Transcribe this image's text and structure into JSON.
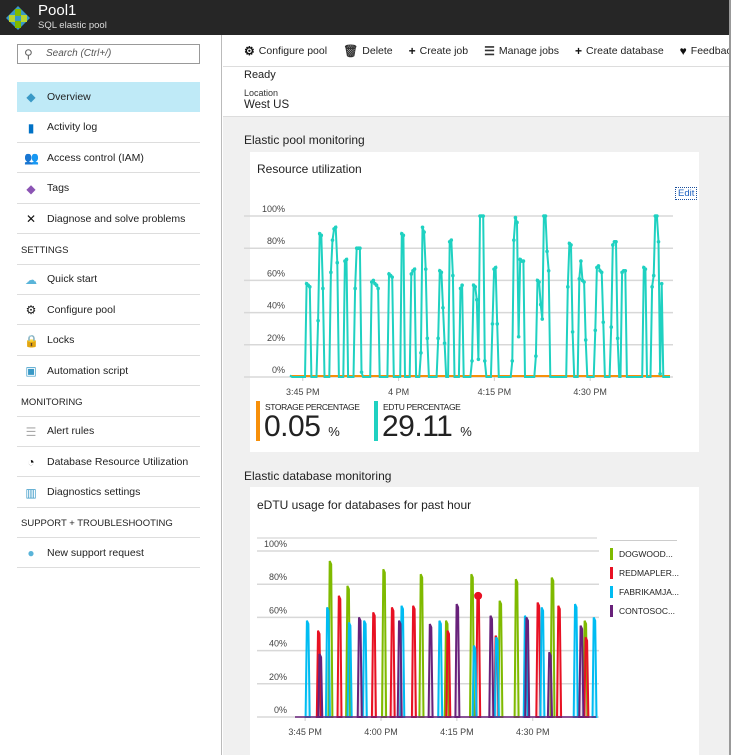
{
  "header": {
    "title": "Pool1",
    "subtitle": "SQL elastic pool",
    "icon": "sql-elastic-pool-icon"
  },
  "sidebar": {
    "search_placeholder": "Search (Ctrl+/)",
    "items": [
      {
        "label": "Overview",
        "icon": "overview-icon",
        "selected": true
      },
      {
        "label": "Activity log",
        "icon": "activity-log-icon"
      },
      {
        "label": "Access control (IAM)",
        "icon": "access-control-icon"
      },
      {
        "label": "Tags",
        "icon": "tag-icon"
      },
      {
        "label": "Diagnose and solve problems",
        "icon": "wrench-icon"
      }
    ],
    "sections": [
      {
        "title": "SETTINGS",
        "items": [
          {
            "label": "Quick start",
            "icon": "cloud-icon"
          },
          {
            "label": "Configure pool",
            "icon": "gear-icon"
          },
          {
            "label": "Locks",
            "icon": "lock-icon"
          },
          {
            "label": "Automation script",
            "icon": "monitor-icon"
          }
        ]
      },
      {
        "title": "MONITORING",
        "items": [
          {
            "label": "Alert rules",
            "icon": "list-icon"
          },
          {
            "label": "Database Resource Utilization",
            "icon": "gauge-icon"
          },
          {
            "label": "Diagnostics settings",
            "icon": "chart-icon"
          }
        ]
      },
      {
        "title": "SUPPORT + TROUBLESHOOTING",
        "items": [
          {
            "label": "New support request",
            "icon": "support-icon"
          }
        ]
      }
    ]
  },
  "toolbar": [
    {
      "label": "Configure pool",
      "icon": "gear-icon"
    },
    {
      "label": "Delete",
      "icon": "trash-icon"
    },
    {
      "label": "Create job",
      "icon": "plus-icon"
    },
    {
      "label": "Manage jobs",
      "icon": "checklist-icon"
    },
    {
      "label": "Create database",
      "icon": "plus-icon"
    },
    {
      "label": "Feedback",
      "icon": "heart-icon"
    }
  ],
  "essentials": {
    "status": "Ready",
    "location_label": "Location",
    "location": "West US"
  },
  "pool_monitoring": {
    "section_title": "Elastic pool monitoring",
    "card_title": "Resource utilization",
    "edit_label": "Edit",
    "storage": {
      "label": "STORAGE PERCENTAGE",
      "value": "0.05",
      "unit": "%",
      "color": "#f7900a"
    },
    "edtu": {
      "label": "EDTU PERCENTAGE",
      "value": "29.11",
      "unit": "%",
      "color": "#1fd1c1"
    }
  },
  "db_monitoring": {
    "section_title": "Elastic database monitoring",
    "card_title": "eDTU usage for databases for past hour"
  },
  "chart_data": [
    {
      "type": "line",
      "xlim": [
        "15:43:00",
        "16:42:30"
      ],
      "ylim": [
        0,
        100
      ],
      "xticks": [
        "3:45 PM",
        "4 PM",
        "4:15 PM",
        "4:30 PM"
      ],
      "yticks": [
        "0%",
        "20%",
        "40%",
        "60%",
        "80%",
        "100%"
      ],
      "grid": true,
      "sample_interval_seconds": 15,
      "series": [
        {
          "name": "EDTU PERCENTAGE",
          "color": "#1fd1c1",
          "spikes": [
            {
              "start": "15:45:36",
              "values": [
                58,
                57,
                56
              ]
            },
            {
              "start": "15:47:24",
              "values": [
                35,
                89,
                88,
                55
              ]
            },
            {
              "start": "15:49:24",
              "values": [
                65,
                85,
                92,
                93,
                71
              ]
            },
            {
              "start": "15:51:36",
              "values": [
                72,
                73
              ]
            },
            {
              "start": "15:53:12",
              "values": [
                55,
                80,
                80,
                80,
                3
              ]
            },
            {
              "start": "15:55:48",
              "values": [
                59,
                60,
                58,
                57,
                55
              ]
            },
            {
              "start": "15:58:30",
              "values": [
                64,
                63,
                62
              ]
            },
            {
              "start": "16:00:30",
              "values": [
                89,
                88
              ]
            },
            {
              "start": "16:02:00",
              "values": [
                64,
                66,
                67
              ]
            },
            {
              "start": "16:03:30",
              "values": [
                15,
                93,
                90,
                67,
                24
              ]
            },
            {
              "start": "16:06:12",
              "values": [
                24,
                66,
                65,
                43,
                21
              ]
            },
            {
              "start": "16:08:00",
              "values": [
                84,
                85,
                63
              ]
            },
            {
              "start": "16:09:42",
              "values": [
                55,
                57
              ]
            },
            {
              "start": "16:11:30",
              "values": [
                10,
                57,
                56,
                48,
                11,
                100,
                100,
                100,
                10
              ]
            },
            {
              "start": "16:14:42",
              "values": [
                33,
                67,
                68,
                33
              ]
            },
            {
              "start": "16:17:48",
              "values": [
                10,
                85,
                99,
                96,
                25,
                73,
                72,
                72
              ]
            },
            {
              "start": "16:21:30",
              "values": [
                13,
                60,
                59,
                45,
                36,
                100,
                100,
                78,
                66
              ]
            },
            {
              "start": "16:26:30",
              "values": [
                56,
                83,
                82,
                28
              ]
            },
            {
              "start": "16:28:18",
              "values": [
                61,
                72,
                60,
                59,
                23
              ]
            },
            {
              "start": "16:30:48",
              "values": [
                29,
                68,
                69,
                66,
                65,
                34
              ]
            },
            {
              "start": "16:33:18",
              "values": [
                31,
                82,
                84,
                84,
                24
              ]
            },
            {
              "start": "16:35:00",
              "values": [
                65,
                66,
                66
              ]
            },
            {
              "start": "16:38:24",
              "values": [
                68,
                67
              ]
            },
            {
              "start": "16:39:42",
              "values": [
                56,
                63,
                100,
                100,
                84,
                2,
                58
              ]
            }
          ]
        },
        {
          "name": "STORAGE PERCENTAGE",
          "color": "#f7900a",
          "constant": 0.05
        }
      ]
    },
    {
      "type": "line",
      "title": "eDTU usage for databases for past hour",
      "xlim": [
        "15:43:00",
        "16:42:30"
      ],
      "ylim": [
        0,
        100
      ],
      "xticks": [
        "3:45 PM",
        "4:00 PM",
        "4:15 PM",
        "4:30 PM"
      ],
      "yticks": [
        "0%",
        "20%",
        "40%",
        "60%",
        "80%",
        "100%"
      ],
      "grid": true,
      "legend": "right",
      "series": [
        {
          "name": "DOGWOOD...",
          "color": "#7fba00",
          "peaks": [
            [
              "15:50:00",
              94
            ],
            [
              "15:53:30",
              79
            ],
            [
              "16:00:36",
              89
            ],
            [
              "16:08:00",
              86
            ],
            [
              "16:13:00",
              58
            ],
            [
              "16:18:00",
              86
            ],
            [
              "16:23:36",
              70
            ],
            [
              "16:26:48",
              83
            ],
            [
              "16:33:54",
              84
            ],
            [
              "16:40:24",
              58
            ]
          ]
        },
        {
          "name": "REDMAPLER...",
          "color": "#e81123",
          "peaks": [
            [
              "15:47:42",
              52
            ],
            [
              "15:51:48",
              73
            ],
            [
              "15:58:36",
              63
            ],
            [
              "16:02:18",
              66
            ],
            [
              "16:06:30",
              67
            ],
            [
              "16:13:18",
              52
            ],
            [
              "16:19:12",
              73
            ],
            [
              "16:22:48",
              49
            ],
            [
              "16:31:06",
              69
            ],
            [
              "16:35:12",
              67
            ],
            [
              "16:40:36",
              48
            ]
          ]
        },
        {
          "name": "FABRIKAMJA...",
          "color": "#00bcf2",
          "peaks": [
            [
              "15:45:30",
              58
            ],
            [
              "15:49:30",
              66
            ],
            [
              "15:53:48",
              57
            ],
            [
              "15:56:48",
              58
            ],
            [
              "16:04:12",
              67
            ],
            [
              "16:11:42",
              58
            ],
            [
              "16:18:30",
              43
            ],
            [
              "16:22:54",
              48
            ],
            [
              "16:28:36",
              61
            ],
            [
              "16:31:54",
              66
            ],
            [
              "16:38:30",
              68
            ],
            [
              "16:42:12",
              60
            ]
          ]
        },
        {
          "name": "CONTOSOC...",
          "color": "#68217a",
          "peaks": [
            [
              "15:48:00",
              38
            ],
            [
              "15:55:48",
              60
            ],
            [
              "16:03:42",
              58
            ],
            [
              "16:09:48",
              56
            ],
            [
              "16:15:06",
              68
            ],
            [
              "16:21:48",
              61
            ],
            [
              "16:28:54",
              60
            ],
            [
              "16:33:24",
              39
            ],
            [
              "16:39:36",
              55
            ]
          ]
        }
      ]
    }
  ]
}
